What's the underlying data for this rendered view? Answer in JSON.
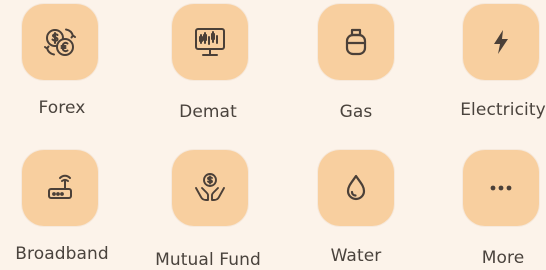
{
  "colors": {
    "page_background": "#fcf3ea",
    "tile_background": "#f8cf9f",
    "icon_stroke": "#4b4038",
    "label_text": "#4a433d"
  },
  "services": [
    {
      "label": "Forex",
      "icon": "currency-exchange-icon"
    },
    {
      "label": "Demat",
      "icon": "stock-chart-monitor-icon"
    },
    {
      "label": "Gas",
      "icon": "gas-cylinder-icon"
    },
    {
      "label": "Electricity",
      "icon": "lightning-bolt-icon"
    },
    {
      "label": "Broadband",
      "icon": "wifi-router-icon"
    },
    {
      "label": "Mutual Fund",
      "icon": "hands-holding-coin-icon"
    },
    {
      "label": "Water",
      "icon": "water-drop-icon"
    },
    {
      "label": "More",
      "icon": "more-dots-icon"
    }
  ]
}
